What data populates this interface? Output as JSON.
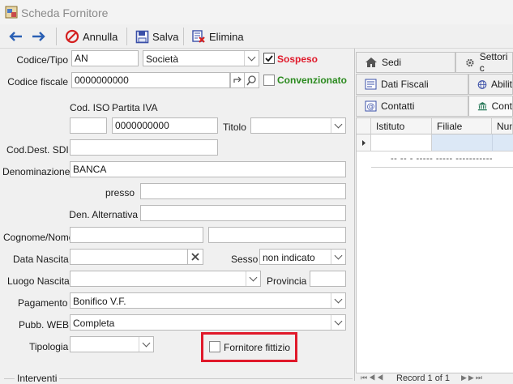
{
  "window": {
    "title": "Scheda Fornitore"
  },
  "toolbar": {
    "annulla": "Annulla",
    "salva": "Salva",
    "elimina": "Elimina"
  },
  "form": {
    "codice_tipo_label": "Codice/Tipo",
    "codice_value": "AN",
    "tipo_value": "Società",
    "sospeso_label": "Sospeso",
    "codice_fiscale_label": "Codice fiscale",
    "codice_fiscale_value": "0000000000",
    "convenzionato_label": "Convenzionato",
    "cod_iso_label": "Cod. ISO",
    "partita_iva_label": "Partita IVA",
    "partita_iva_value": "0000000000",
    "titolo_label": "Titolo",
    "cod_dest_sdi_label": "Cod.Dest. SDI",
    "denominazione_label": "Denominazione",
    "denominazione_value": "BANCA",
    "presso_label": "presso",
    "den_alternativa_label": "Den. Alternativa",
    "cognome_nome_label": "Cognome/Nome",
    "data_nascita_label": "Data Nascita",
    "sesso_label": "Sesso",
    "sesso_value": "non indicato",
    "luogo_nascita_label": "Luogo Nascita",
    "provincia_label": "Provincia",
    "pagamento_label": "Pagamento",
    "pagamento_value": "Bonifico V.F.",
    "pubb_web_label": "Pubb. WEB",
    "pubb_web_value": "Completa",
    "tipologia_label": "Tipologia",
    "fornitore_fittizio_label": "Fornitore fittizio",
    "interventi_label": "Interventi"
  },
  "tabs": {
    "sedi": "Sedi",
    "settori": "Settori c",
    "dati_fiscali": "Dati Fiscali",
    "abilit": "Abilit",
    "contatti": "Contatti",
    "cont": "Cont"
  },
  "grid": {
    "columns": [
      "Istituto",
      "Filiale",
      "Num"
    ],
    "empty_text": "-- -- - ----- ----- -----------",
    "pager_text": "Record 1 of 1"
  },
  "colors": {
    "sospeso": "#e0192a",
    "convenzionato": "#2a8a1e",
    "highlight": "#e0192a",
    "nav_arrow": "#2a5fb4"
  }
}
